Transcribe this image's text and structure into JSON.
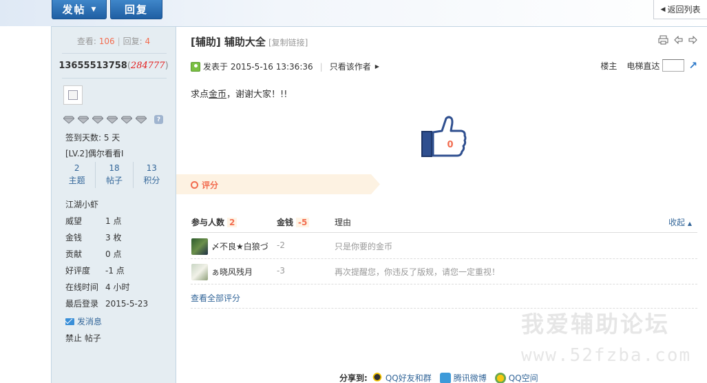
{
  "toolbar": {
    "post_label": "发帖",
    "reply_label": "回复",
    "back_label": "返回列表"
  },
  "sidebar": {
    "stats": {
      "views_label": "查看:",
      "views": "106",
      "replies_label": "回复:",
      "replies": "4"
    },
    "user": {
      "name": "13655513758",
      "points": "284777"
    },
    "checkin": "签到天数: 5 天",
    "level": "[LV.2]偶尔看看I",
    "counts": [
      {
        "value": "2",
        "label": "主题"
      },
      {
        "value": "18",
        "label": "帖子"
      },
      {
        "value": "13",
        "label": "积分"
      }
    ],
    "rank": "江湖小虾",
    "props": [
      {
        "key": "威望",
        "value": "1 点"
      },
      {
        "key": "金钱",
        "value": "3 枚"
      },
      {
        "key": "贡献",
        "value": "0 点"
      },
      {
        "key": "好评度",
        "value": "-1 点"
      },
      {
        "key": "在线时间",
        "value": "4 小时"
      },
      {
        "key": "最后登录",
        "value": "2015-5-23"
      }
    ],
    "send_message": "发消息",
    "ban_label": "禁止 帖子"
  },
  "post": {
    "title": "[辅助] 辅助大全",
    "copy_link": "[复制链接]",
    "posted_at": "发表于 2015-5-16 13:36:36",
    "only_author": "只看该作者",
    "floor_label": "楼主",
    "jump_label": "电梯直达",
    "content_pre": "求点",
    "content_link": "金币",
    "content_post": "，谢谢大家！!!",
    "like_count": "0"
  },
  "rating": {
    "label": "评分",
    "header": {
      "participants_label": "参与人数",
      "participants": "2",
      "money_label": "金钱",
      "money": "-5",
      "reason_label": "理由",
      "collapse_label": "收起"
    },
    "rows": [
      {
        "name": "〆不良★白狼づ",
        "money": "-2",
        "reason": "只是你要的金币"
      },
      {
        "name": "ぁ晓风残月",
        "money": "-3",
        "reason": "再次提醒您，你违反了版规，请您一定重视！"
      }
    ],
    "view_all": "查看全部评分"
  },
  "watermark": {
    "line1": "我爱辅助论坛",
    "line2": "www.52fzba.com"
  },
  "share": {
    "label": "分享到:",
    "items": [
      {
        "label": "QQ好友和群"
      },
      {
        "label": "腾讯微博"
      },
      {
        "label": "QQ空间"
      }
    ]
  }
}
